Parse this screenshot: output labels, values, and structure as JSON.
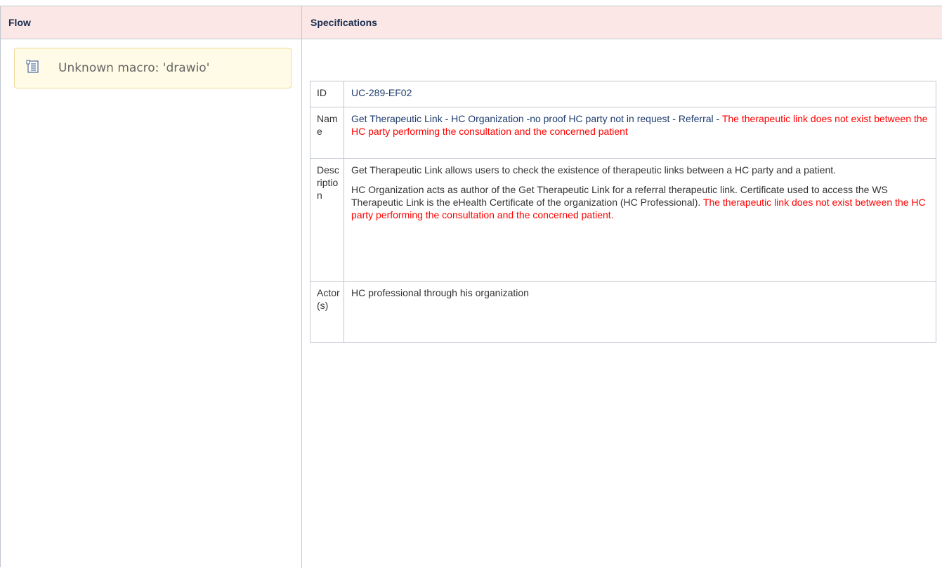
{
  "header": {
    "flow": "Flow",
    "specifications": "Specifications"
  },
  "macro": {
    "icon": "document-icon",
    "text": "Unknown macro: 'drawio'"
  },
  "spec": {
    "id_label": "ID",
    "id_value": "UC-289-EF02",
    "name_label": "Name",
    "name_value_part1": "Get Therapeutic Link -  HC Organization -no proof HC party not in request - Referral - ",
    "name_value_part2": "The therapeutic link does not exist between the HC party performing the consultation and the concerned patient",
    "description_label": "Description",
    "description_para1": "Get Therapeutic Link allows users to check the existence of therapeutic links between a HC party and a patient.",
    "description_para2_part1": "HC Organization acts as author of the Get Therapeutic Link for a referral therapeutic link. Certificate used to access the WS Therapeutic Link is the eHealth Certificate of the organization (HC Professional). ",
    "description_para2_part2": "The therapeutic link does not exist between the HC party performing the consultation and the concerned patient.",
    "actors_label": "Actor(s)",
    "actors_value": "HC professional through his organization"
  },
  "colors": {
    "header_bg": "#fbe8e6",
    "highlight_red": "#ff0000",
    "link_blue": "#1f3c6e"
  }
}
